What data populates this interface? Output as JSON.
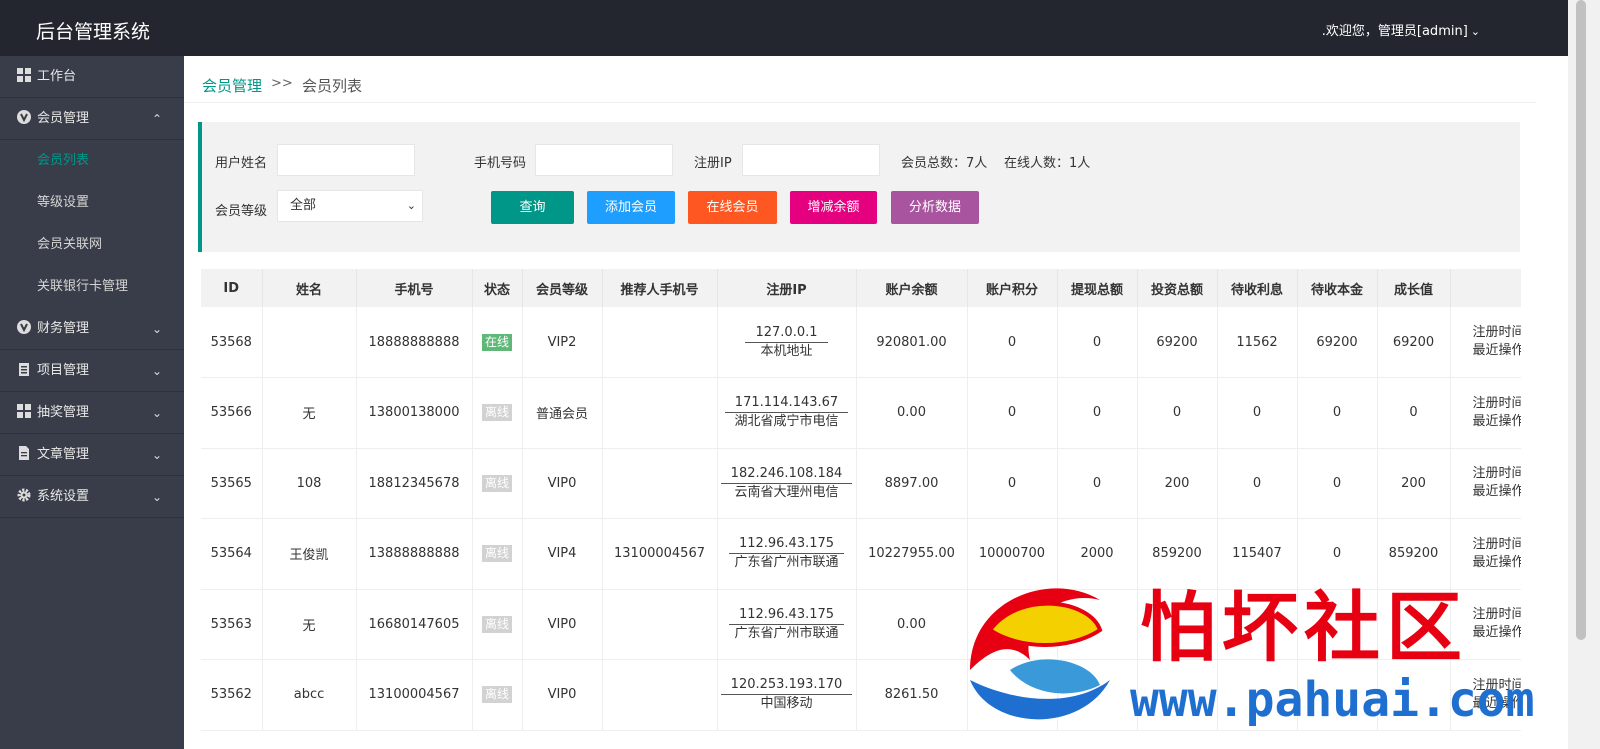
{
  "header": {
    "title": "后台管理系统",
    "user_label": ".欢迎您，管理员[admin]"
  },
  "sidebar": {
    "items": [
      {
        "label": "工作台"
      },
      {
        "label": "会员管理"
      },
      {
        "label": "财务管理"
      },
      {
        "label": "项目管理"
      },
      {
        "label": "抽奖管理"
      },
      {
        "label": "文章管理"
      },
      {
        "label": "系统设置"
      }
    ],
    "sub_items": [
      {
        "label": "会员列表"
      },
      {
        "label": "等级设置"
      },
      {
        "label": "会员关联网"
      },
      {
        "label": "关联银行卡管理"
      }
    ]
  },
  "breadcrumb": {
    "parent": "会员管理",
    "sep": ">>",
    "current": "会员列表"
  },
  "filter": {
    "username_label": "用户姓名",
    "phone_label": "手机号码",
    "ip_label": "注册IP",
    "member_total": "会员总数：7人",
    "online_total": "在线人数：1人",
    "level_label": "会员等级",
    "level_value": "全部",
    "buttons": [
      {
        "label": "查询",
        "color": "#009688"
      },
      {
        "label": "添加会员",
        "color": "#1e9fff"
      },
      {
        "label": "在线会员",
        "color": "#ff5722"
      },
      {
        "label": "增减余额",
        "color": "#e5007f"
      },
      {
        "label": "分析数据",
        "color": "#a9549f"
      }
    ]
  },
  "table": {
    "headers": [
      "ID",
      "姓名",
      "手机号",
      "状态",
      "会员等级",
      "推荐人手机号",
      "注册IP",
      "账户余额",
      "账户积分",
      "提现总额",
      "投资总额",
      "待收利息",
      "待收本金",
      "成长值",
      ""
    ],
    "rows": [
      {
        "id": "53568",
        "name": "",
        "phone": "18888888888",
        "status": "在线",
        "online": true,
        "level": "VIP2",
        "ref": "",
        "ip": "127.0.0.1",
        "loc": "本机地址",
        "balance": "920801.00",
        "points": "0",
        "withdraw": "0",
        "invest": "69200",
        "interest": "11562",
        "principal": "69200",
        "growth": "69200",
        "op1": "注册时间",
        "op2": "最近操作"
      },
      {
        "id": "53566",
        "name": "无",
        "phone": "13800138000",
        "status": "离线",
        "online": false,
        "level": "普通会员",
        "ref": "",
        "ip": "171.114.143.67",
        "loc": "湖北省咸宁市电信",
        "balance": "0.00",
        "points": "0",
        "withdraw": "0",
        "invest": "0",
        "interest": "0",
        "principal": "0",
        "growth": "0",
        "op1": "注册时间",
        "op2": "最近操作"
      },
      {
        "id": "53565",
        "name": "108",
        "phone": "18812345678",
        "status": "离线",
        "online": false,
        "level": "VIP0",
        "ref": "",
        "ip": "182.246.108.184",
        "loc": "云南省大理州电信",
        "balance": "8897.00",
        "points": "0",
        "withdraw": "0",
        "invest": "200",
        "interest": "0",
        "principal": "0",
        "growth": "200",
        "op1": "注册时间",
        "op2": "最近操作"
      },
      {
        "id": "53564",
        "name": "王俊凯",
        "phone": "13888888888",
        "status": "离线",
        "online": false,
        "level": "VIP4",
        "ref": "13100004567",
        "ip": "112.96.43.175",
        "loc": "广东省广州市联通",
        "balance": "10227955.00",
        "points": "10000700",
        "withdraw": "2000",
        "invest": "859200",
        "interest": "115407",
        "principal": "0",
        "growth": "859200",
        "op1": "注册时间",
        "op2": "最近操作"
      },
      {
        "id": "53563",
        "name": "无",
        "phone": "16680147605",
        "status": "离线",
        "online": false,
        "level": "VIP0",
        "ref": "",
        "ip": "112.96.43.175",
        "loc": "广东省广州市联通",
        "balance": "0.00",
        "points": "",
        "withdraw": "",
        "invest": "",
        "interest": "",
        "principal": "",
        "growth": "",
        "op1": "注册时间",
        "op2": "最近操作"
      },
      {
        "id": "53562",
        "name": "abcc",
        "phone": "13100004567",
        "status": "离线",
        "online": false,
        "level": "VIP0",
        "ref": "",
        "ip": "120.253.193.170",
        "loc": "中国移动",
        "balance": "8261.50",
        "points": "",
        "withdraw": "",
        "invest": "",
        "interest": "",
        "principal": "",
        "growth": "",
        "op1": "注册时间",
        "op2": "最近操作"
      }
    ]
  },
  "watermark": {
    "text": "怕坏社区",
    "url": "www.pahuai.com"
  }
}
